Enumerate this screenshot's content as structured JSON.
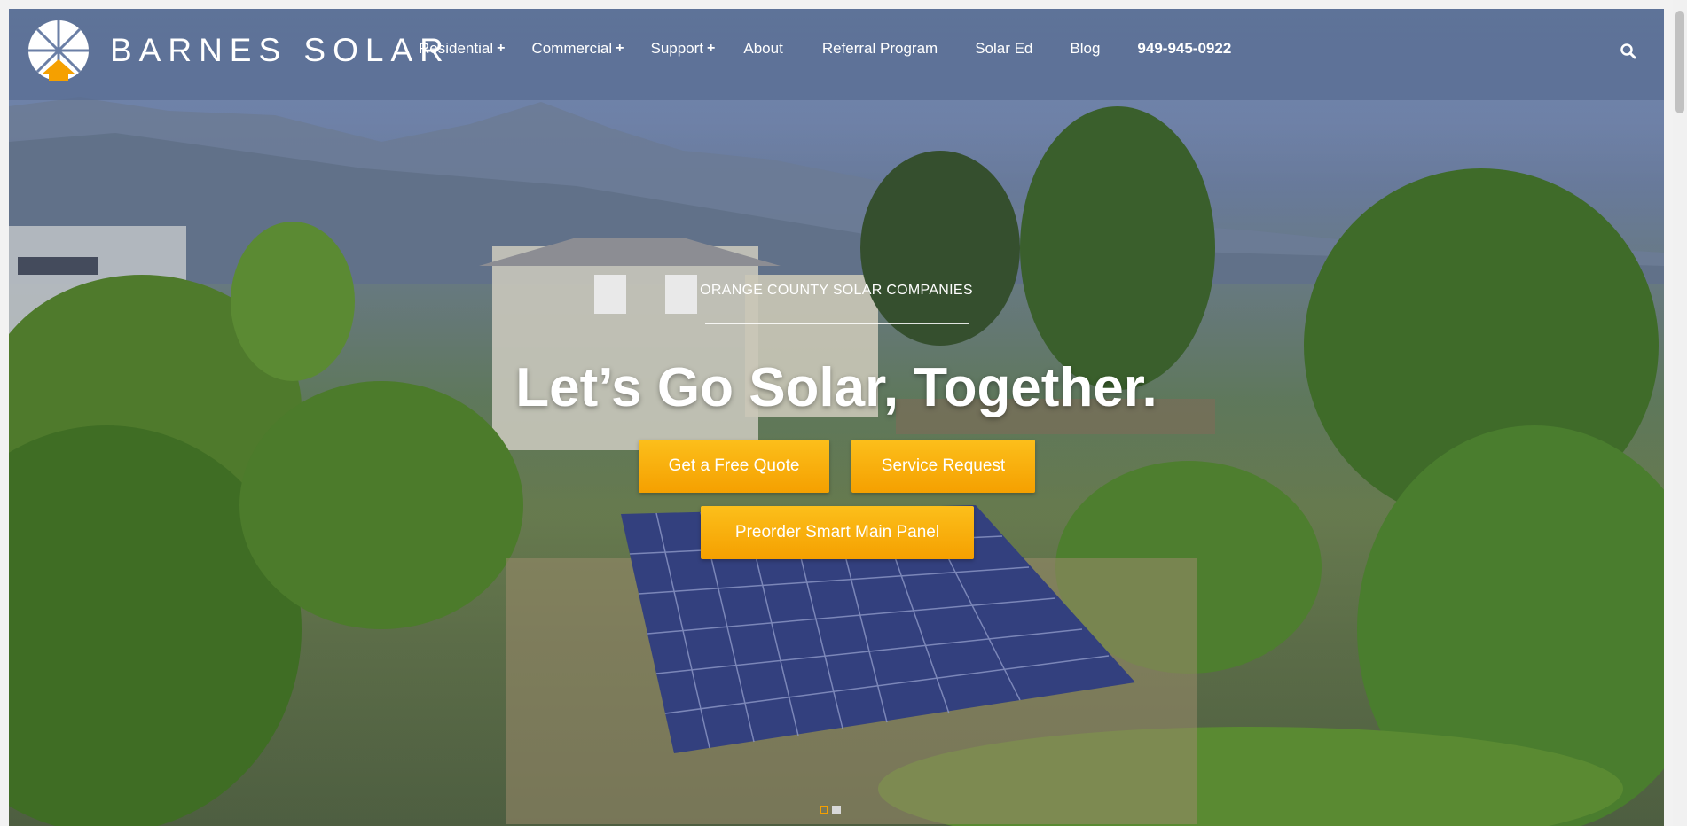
{
  "brand": {
    "name": "BARNES SOLAR"
  },
  "nav": {
    "items": [
      {
        "label": "Residential",
        "has_submenu": true
      },
      {
        "label": "Commercial",
        "has_submenu": true
      },
      {
        "label": "Support",
        "has_submenu": true
      },
      {
        "label": "About",
        "has_submenu": false
      },
      {
        "label": "Referral Program",
        "has_submenu": false
      },
      {
        "label": "Solar Ed",
        "has_submenu": false
      },
      {
        "label": "Blog",
        "has_submenu": false
      }
    ],
    "submenu_glyph": "+",
    "phone": "949-945-0922",
    "search_icon": "search-icon"
  },
  "hero": {
    "tagline": "ORANGE COUNTY SOLAR COMPANIES",
    "headline": "Let’s Go Solar, Together.",
    "buttons": {
      "quote": "Get a Free Quote",
      "service": "Service Request",
      "preorder": "Preorder Smart Main Panel"
    },
    "slides": {
      "count": 2,
      "active": 1
    }
  },
  "colors": {
    "accent": "#f5a000",
    "overlay": "#586c92",
    "text": "#ffffff"
  }
}
